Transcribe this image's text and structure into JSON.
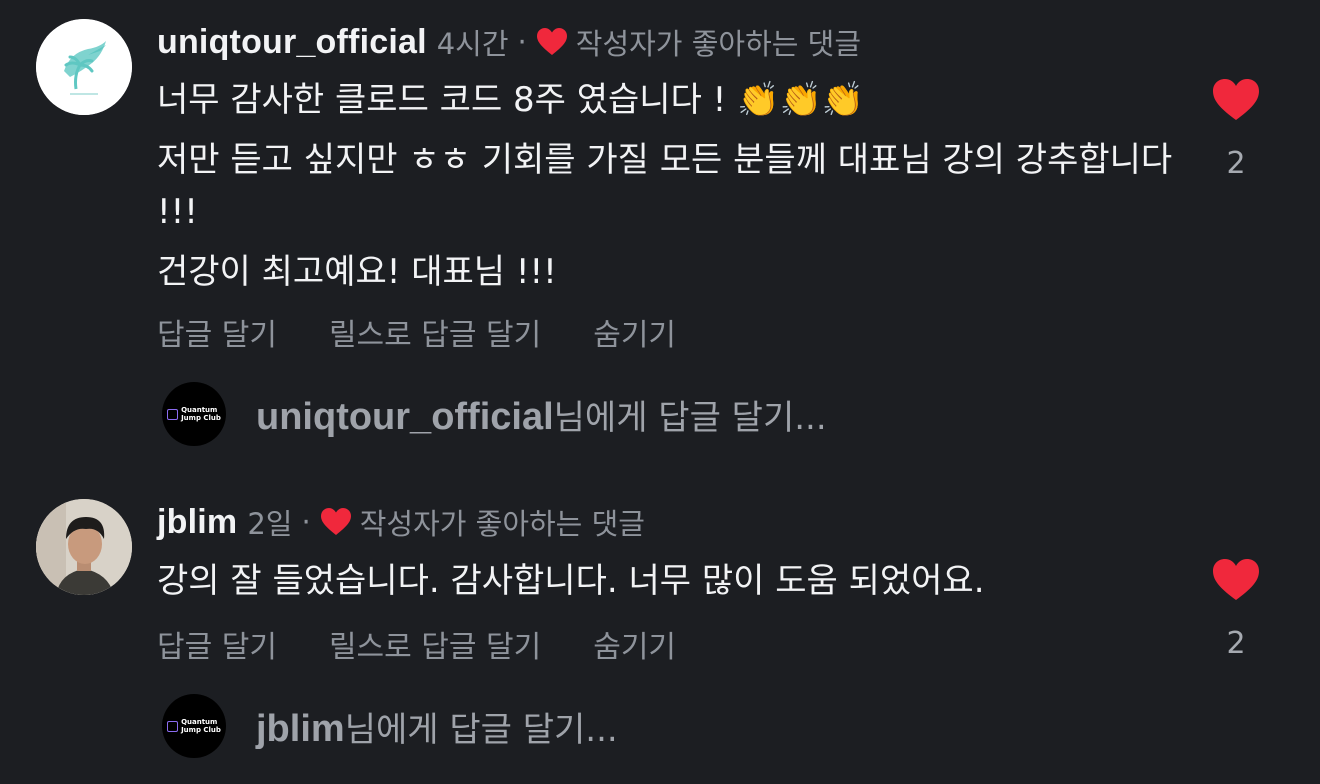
{
  "comments": [
    {
      "username": "uniqtour_official",
      "time": "4시간",
      "separator": "·",
      "liked_label": "작성자가 좋아하는 댓글",
      "lines": [
        "너무 감사한 클로드 코드 8주 였습니다 ! ",
        "저만 듣고 싶지만 ㅎㅎ 기회를 가질 모든 분들께 대표님 강의 강추합니다 !!!",
        "건강이 최고예요! 대표님 !!!"
      ],
      "emoji": "👏👏👏",
      "like_count": "2",
      "actions": [
        "답글 달기",
        "릴스로 답글 달기",
        "숨기기"
      ],
      "reply_user": "uniqtour_official",
      "reply_suffix": "님에게 답글 달기..."
    },
    {
      "username": "jblim",
      "time": "2일",
      "separator": "·",
      "liked_label": "작성자가 좋아하는 댓글",
      "lines": [
        "강의 잘 들었습니다. 감사합니다. 너무 많이 도움 되었어요."
      ],
      "like_count": "2",
      "actions": [
        "답글 달기",
        "릴스로 답글 달기",
        "숨기기"
      ],
      "reply_user": "jblim",
      "reply_suffix": "님에게 답글 달기..."
    }
  ],
  "reply_avatar": {
    "line1": "Quantum",
    "line2": "Jump Club"
  },
  "icons": {
    "avatar_1": "palm-plane-logo-icon",
    "avatar_2": "person-photo",
    "heart": "heart-icon"
  },
  "colors": {
    "background": "#1c1e22",
    "text": "#f2f3f5",
    "muted": "#8e939b",
    "heart": "#f0283c",
    "logo_teal": "#5fc7c2",
    "qjc_accent": "#8b6cf0"
  }
}
